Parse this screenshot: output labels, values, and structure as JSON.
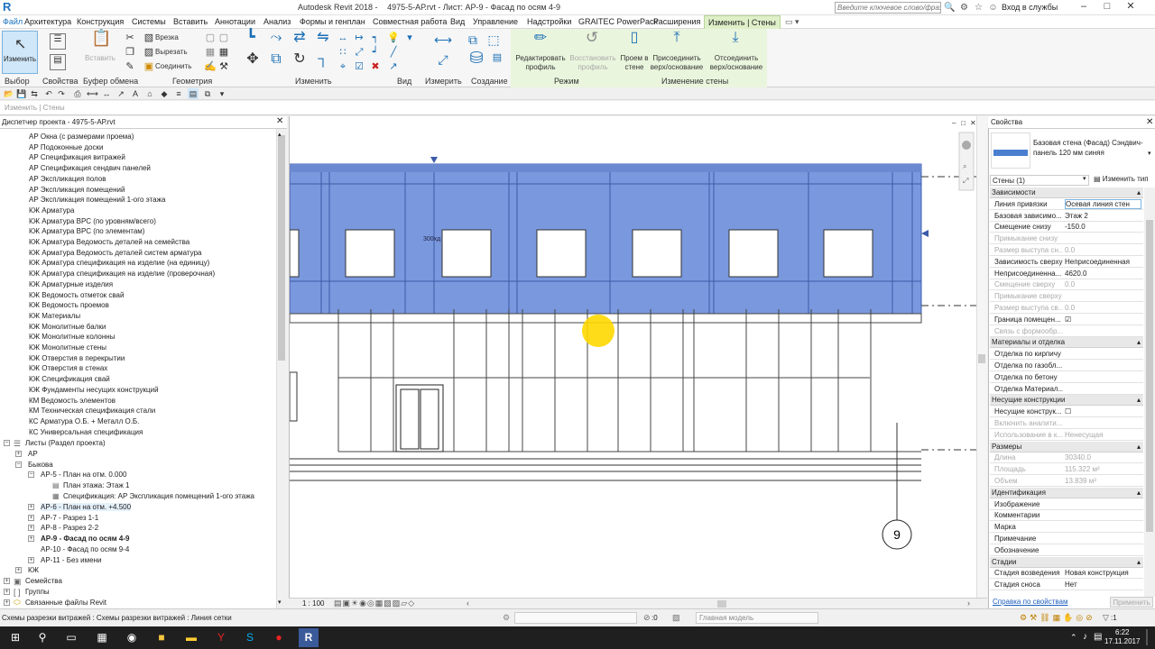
{
  "title_bar": {
    "app_title": "Autodesk Revit 2018 -",
    "file_sheet": "4975-5-АР.rvt - Лист: АР-9 - Фасад по осям 4-9",
    "search_placeholder": "Введите ключевое слово/фразу",
    "sign_in": "Вход в службы"
  },
  "menu": {
    "file": "Файл",
    "tabs": [
      "Архитектура",
      "Конструкция",
      "Системы",
      "Вставить",
      "Аннотации",
      "Анализ",
      "Формы и генплан",
      "Совместная работа",
      "Вид",
      "Управление",
      "Надстройки",
      "GRAITEC PowerPack",
      "Расширения",
      "Изменить | Стены"
    ]
  },
  "ribbon": {
    "modify": "Изменить",
    "paste": "Вставить",
    "cut": "Врезка",
    "cut2": "Вырезать",
    "join": "Соединить",
    "edit_profile": "Редактировать профиль",
    "reset_profile": "Восстановить профиль",
    "wall_opening": "Проем в стене",
    "attach": "Присоединить верх/основание",
    "detach": "Отсоединить верх/основание",
    "panels": [
      "Выбор",
      "Свойства",
      "Буфер обмена",
      "Геометрия",
      "Изменить",
      "Вид",
      "Измерить",
      "Создание",
      "Режим",
      "Изменение стены"
    ]
  },
  "options_bar": {
    "label": "Изменить | Стены"
  },
  "project_browser": {
    "title": "Диспетчер проекта - 4975-5-АР.rvt",
    "items": [
      "АР Окна (с размерами проема)",
      "АР Подоконные доски",
      "АР Спецификация витражей",
      "АР Спецификация сендвич панелей",
      "АР Экспликация полов",
      "АР Экспликация помещений",
      "АР Экспликация помещений 1-ого этажа",
      "КЖ Арматура",
      "КЖ Арматура ВРС (по уровням/всего)",
      "КЖ Арматура ВРС (по элементам)",
      "КЖ Арматура Ведомость деталей на семейства",
      "КЖ Арматура Ведомость деталей систем арматура",
      "КЖ Арматура спецификация на изделие (на единицу)",
      "КЖ Арматура спецификация на изделие (проверочная)",
      "КЖ Арматурные изделия",
      "КЖ Ведомость отметок свай",
      "КЖ Ведомость проемов",
      "КЖ Материалы",
      "КЖ Монолитные балки",
      "КЖ Монолитные колонны",
      "КЖ Монолитные стены",
      "КЖ Отверстия в перекрытии",
      "КЖ Отверстия в стенах",
      "КЖ Спецификация свай",
      "КЖ Фундаменты несущих конструкций",
      "КМ Ведомость элементов",
      "КМ Техническая спецификация стали",
      "КС Арматура О.Б. + Металл О.Б.",
      "КС Универсальная спецификация"
    ],
    "sheets_root": "Листы (Раздел проекта)",
    "ar": "АР",
    "bykova": "Быкова",
    "ar5": "АР-5 - План на отм. 0.000",
    "ar5_plan": "План этажа: Этаж 1",
    "ar5_spec": "Спецификация: АР Экспликация помещений 1-ого этажа",
    "ar6": "АР-6 - План на отм. +4.500",
    "ar7": "АР-7 - Разрез 1-1",
    "ar8": "АР-8 - Разрез 2-2",
    "ar9": "АР-9 - Фасад по осям 4-9",
    "ar10": "АР-10 - Фасад по осям 9-4",
    "ar11": "АР-11 - Без имени",
    "kzh": "КЖ",
    "families": "Семейства",
    "groups": "Группы",
    "links": "Связанные файлы Revit"
  },
  "view": {
    "scale": "1 : 100",
    "grid_label": "9",
    "dim_text": "300хд"
  },
  "properties": {
    "title": "Свойства",
    "type_name": "Базовая стена (Фасад) Сэндвич-панель 120 мм синяя",
    "filter": "Стены (1)",
    "edit_type": "Изменить тип",
    "groups": [
      {
        "name": "Зависимости",
        "rows": [
          [
            "Линия привязки",
            "Осевая линия стен",
            false
          ],
          [
            "Базовая зависимо...",
            "Этаж 2",
            false
          ],
          [
            "Смещение снизу",
            "-150.0",
            false
          ],
          [
            "Примыкание снизу",
            "",
            true
          ],
          [
            "Размер выступа сн...",
            "0.0",
            true
          ],
          [
            "Зависимость сверху",
            "Неприсоединенная",
            false
          ],
          [
            "Неприсоединенна...",
            "4620.0",
            false
          ],
          [
            "Смещение сверху",
            "0.0",
            true
          ],
          [
            "Примыкание сверху",
            "",
            true
          ],
          [
            "Размер выступа св...",
            "0.0",
            true
          ],
          [
            "Граница помещен...",
            "☑",
            false
          ],
          [
            "Связь с формообр...",
            "",
            true
          ]
        ]
      },
      {
        "name": "Материалы и отделка",
        "rows": [
          [
            "Отделка по кирпичу",
            "",
            false
          ],
          [
            "Отделка по газобл...",
            "",
            false
          ],
          [
            "Отделка по бетону",
            "",
            false
          ],
          [
            "Отделка Материал...",
            "",
            false
          ]
        ]
      },
      {
        "name": "Несущие конструкции",
        "rows": [
          [
            "Несущие конструк...",
            "☐",
            false
          ],
          [
            "Включить аналити...",
            "",
            true
          ],
          [
            "Использование в к...",
            "Ненесущая",
            true
          ]
        ]
      },
      {
        "name": "Размеры",
        "rows": [
          [
            "Длина",
            "30340.0",
            true
          ],
          [
            "Площадь",
            "115.322 м²",
            true
          ],
          [
            "Объем",
            "13.839 м³",
            true
          ]
        ]
      },
      {
        "name": "Идентификация",
        "rows": [
          [
            "Изображение",
            "",
            false
          ],
          [
            "Комментарии",
            "",
            false
          ],
          [
            "Марка",
            "",
            false
          ],
          [
            "Примечание",
            "",
            false
          ],
          [
            "Обозначение",
            "",
            false
          ]
        ]
      },
      {
        "name": "Стадии",
        "rows": [
          [
            "Стадия возведения",
            "Новая конструкция",
            false
          ],
          [
            "Стадия сноса",
            "Нет",
            false
          ]
        ]
      }
    ],
    "help_link": "Справка по свойствам",
    "apply": "Применить"
  },
  "status": {
    "text": "Схемы разрезки витражей : Схемы разрезки витражей : Линия сетки",
    "zero": ":0",
    "model": "Главная модель",
    "filter_count": ":1"
  },
  "taskbar": {
    "time": "6:22",
    "date": "17.11.2017"
  },
  "colors": {
    "accent": "#1e73be",
    "wall_selected": "#6d8fd6",
    "context_tab": "#dff0c9"
  }
}
